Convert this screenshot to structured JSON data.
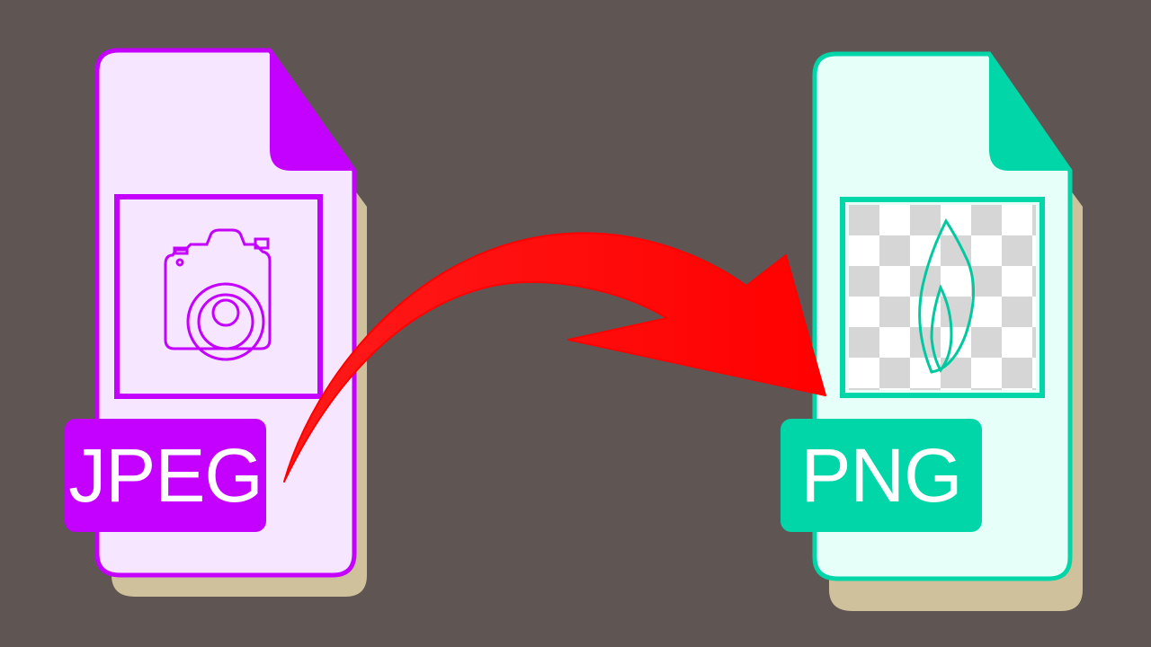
{
  "source_file": {
    "format_label": "JPEG",
    "accent_color": "#c400ff",
    "paper_color": "#f7e6ff",
    "icon": "camera-icon"
  },
  "target_file": {
    "format_label": "PNG",
    "accent_color": "#00d6a8",
    "paper_color": "#e6fff9",
    "icon": "flame-icon"
  },
  "arrow": {
    "color": "#ff0000",
    "direction": "left-to-right"
  },
  "background_color": "#5f5654",
  "shadow_color": "#cfc19b"
}
